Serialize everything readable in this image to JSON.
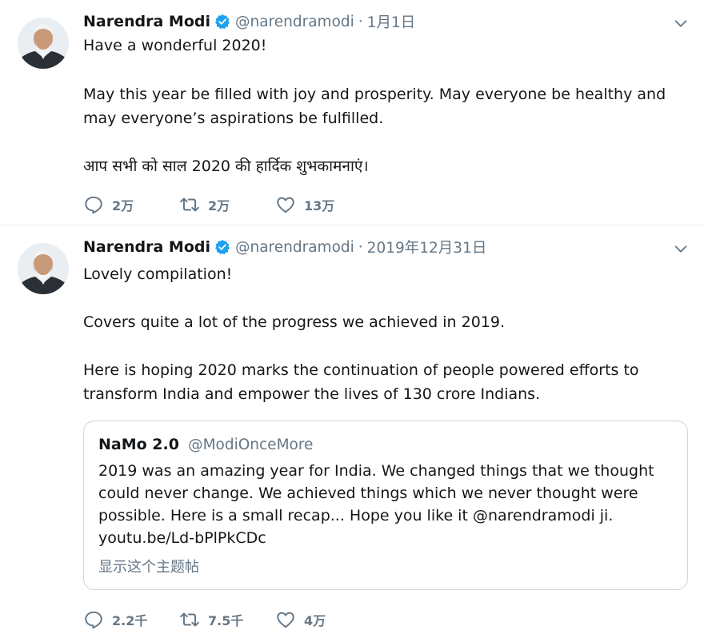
{
  "colors": {
    "verified": "#1da1f2",
    "secondary_text": "#657786",
    "divider": "#e6ecf0"
  },
  "tweets": [
    {
      "author": {
        "name": "Narendra Modi",
        "handle": "@narendramodi",
        "verified": true
      },
      "separator": "·",
      "date": "1月1日",
      "lines": [
        "Have a wonderful 2020!",
        "May this year be filled with joy and prosperity. May everyone be healthy and may everyone’s aspirations be fulfilled.",
        "आप सभी को साल 2020 की हार्दिक शुभकामनाएं।"
      ],
      "stats": {
        "replies": "2万",
        "retweets": "2万",
        "likes": "13万"
      }
    },
    {
      "author": {
        "name": "Narendra Modi",
        "handle": "@narendramodi",
        "verified": true
      },
      "separator": "·",
      "date": "2019年12月31日",
      "lines": [
        "Lovely compilation!",
        "Covers quite a lot of the progress we achieved in 2019.",
        "Here is hoping 2020 marks the continuation of people powered efforts to transform India and empower the lives of 130 crore Indians."
      ],
      "quote": {
        "name": "NaMo 2.0",
        "handle": "@ModiOnceMore",
        "text": "2019 was an amazing year for India. We changed things that we thought could never change. We achieved things which we never thought were possible. Here is a small recap... Hope you like it @narendramodi ji. youtu.be/Ld-bPlPkCDc",
        "show_thread": "显示这个主题帖"
      },
      "stats": {
        "replies": "2.2千",
        "retweets": "7.5千",
        "likes": "4万"
      }
    }
  ]
}
